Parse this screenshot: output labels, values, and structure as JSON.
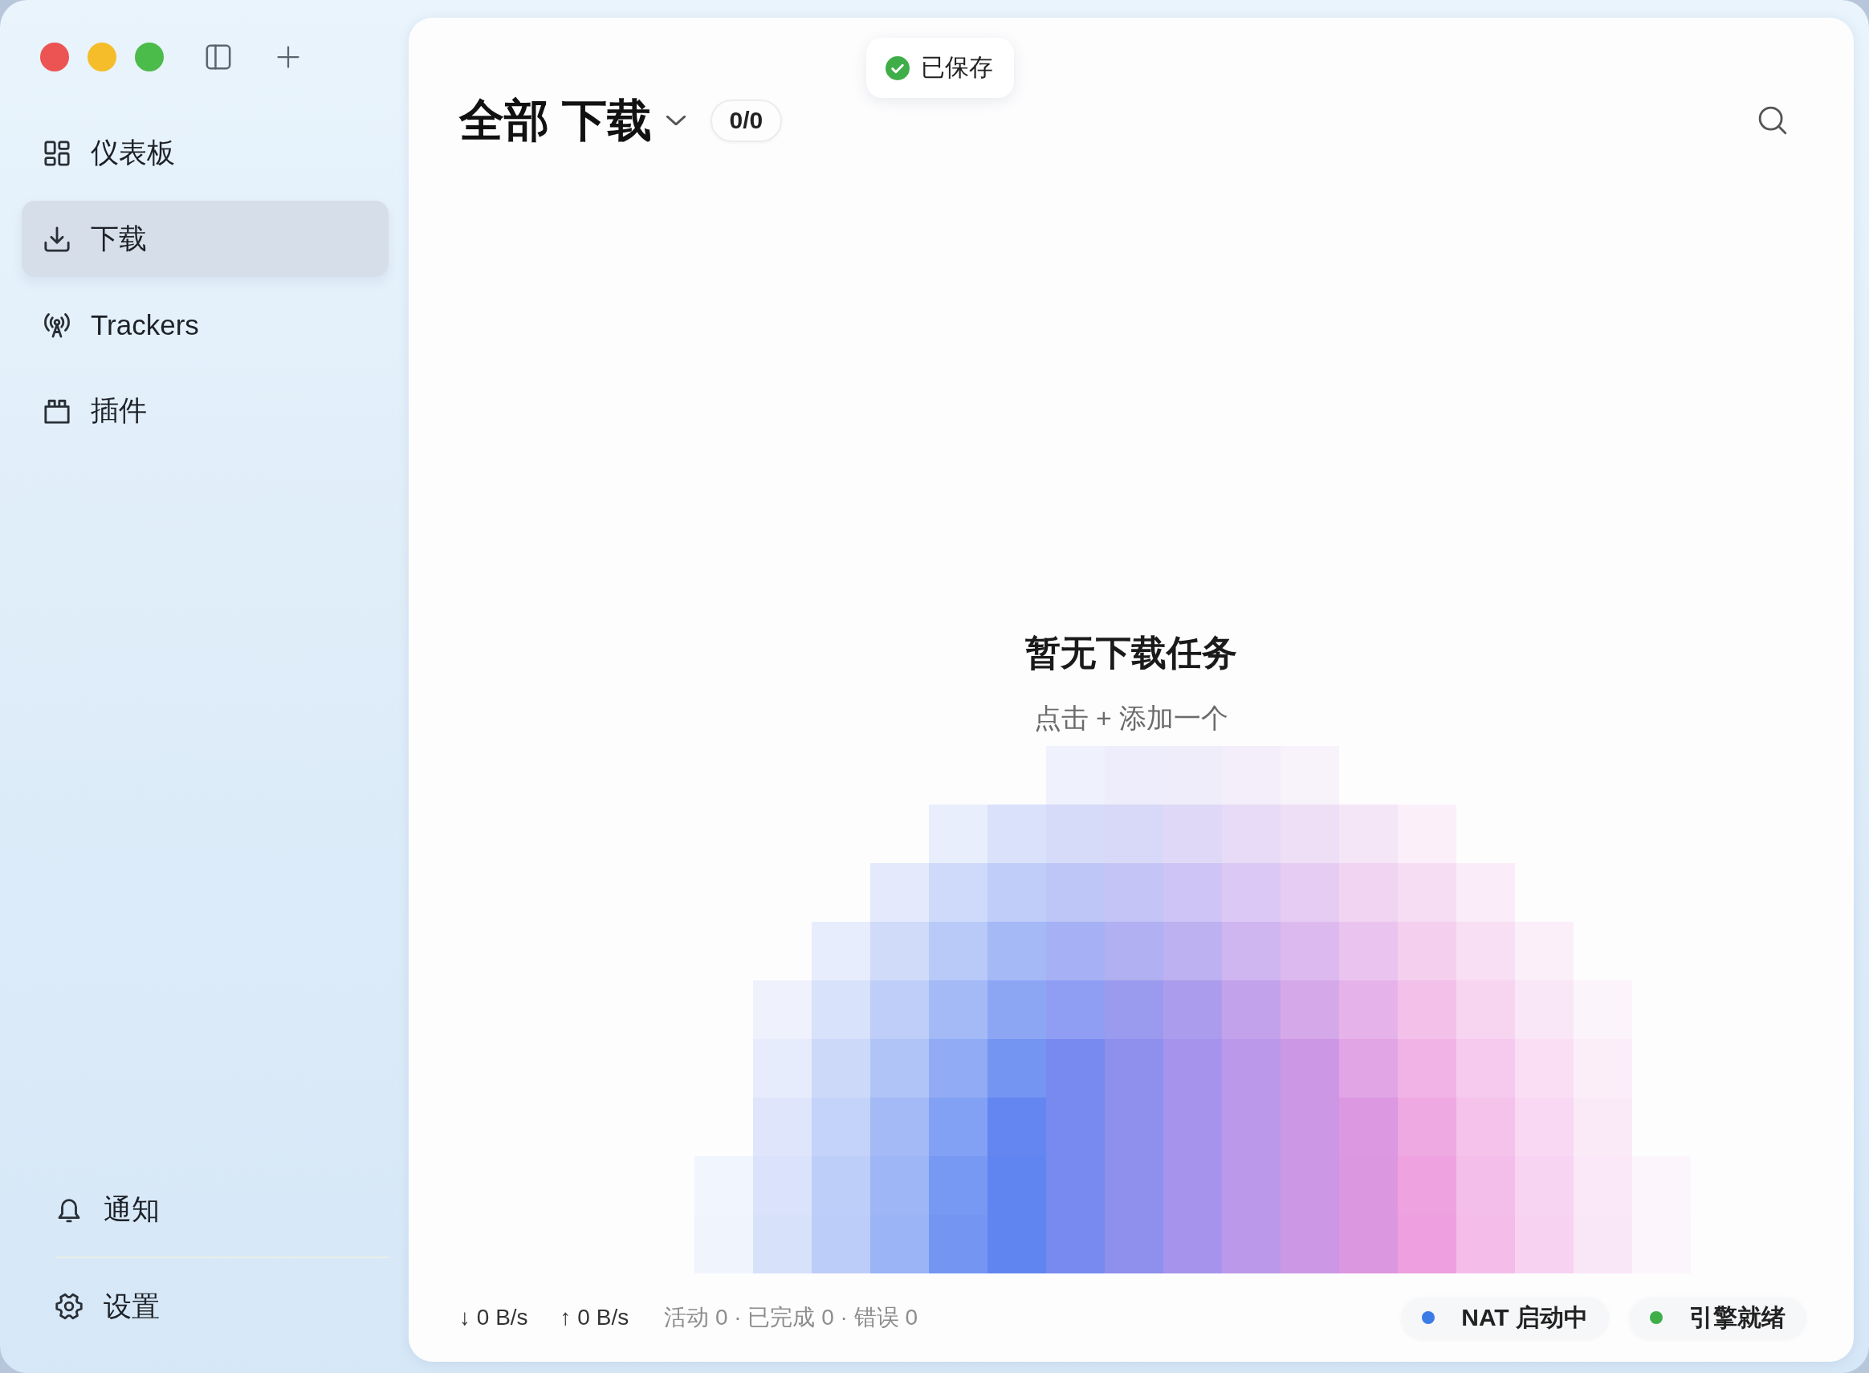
{
  "toast": {
    "message": "已保存"
  },
  "sidebar": {
    "items": [
      {
        "kind": "dashboard",
        "label": "仪表板",
        "selected": false
      },
      {
        "kind": "downloads",
        "label": "下载",
        "selected": true
      },
      {
        "kind": "trackers",
        "label": "Trackers",
        "selected": false
      },
      {
        "kind": "plugins",
        "label": "插件",
        "selected": false
      }
    ],
    "footer_items": [
      {
        "kind": "notifications",
        "label": "通知",
        "selected": false
      },
      {
        "kind": "settings",
        "label": "设置",
        "selected": false
      }
    ]
  },
  "header": {
    "title": "全部 下载",
    "count": "0/0"
  },
  "empty_state": {
    "title": "暂无下载任务",
    "hint": "点击 + 添加一个"
  },
  "status_bar": {
    "download_speed": "↓ 0 B/s",
    "upload_speed": "↑ 0 B/s",
    "stats": "活动 0 · 已完成 0 · 错误 0",
    "indicators": [
      {
        "label": "NAT 启动中",
        "color": "#3b7be6"
      },
      {
        "label": "引擎就绪",
        "color": "#3fae49"
      }
    ]
  }
}
